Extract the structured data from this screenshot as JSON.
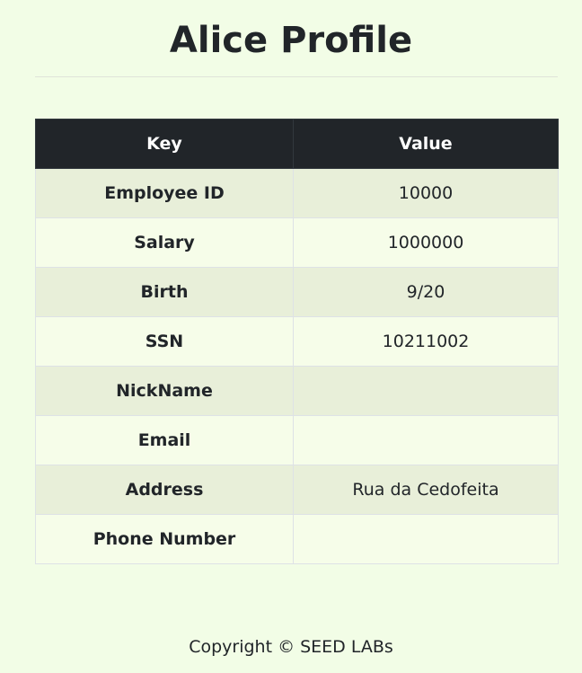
{
  "page": {
    "title": "Alice Profile",
    "footer": "Copyright © SEED LABs"
  },
  "table": {
    "headers": [
      "Key",
      "Value"
    ],
    "rows": [
      {
        "key": "Employee ID",
        "value": "10000"
      },
      {
        "key": "Salary",
        "value": "1000000"
      },
      {
        "key": "Birth",
        "value": "9/20"
      },
      {
        "key": "SSN",
        "value": "10211002"
      },
      {
        "key": "NickName",
        "value": ""
      },
      {
        "key": "Email",
        "value": ""
      },
      {
        "key": "Address",
        "value": "Rua da Cedofeita"
      },
      {
        "key": "Phone Number",
        "value": ""
      }
    ]
  },
  "colors": {
    "background": "#f2fde6",
    "header_bg": "#212529",
    "row_striped": "#e8efd9",
    "row_plain": "#f6fde9",
    "text": "#212529"
  }
}
